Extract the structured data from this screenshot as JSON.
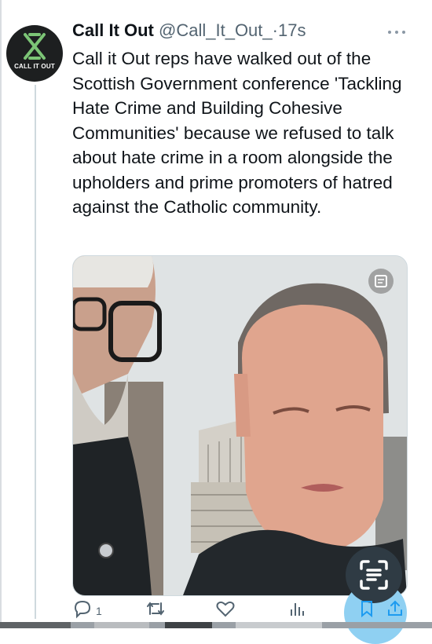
{
  "tweet": {
    "display_name": "Call It Out",
    "handle": "@Call_It_Out_",
    "separator": "·",
    "timestamp": "17s",
    "text": "Call it Out reps have walked out of the Scottish Government conference 'Tackling Hate Crime and Building Cohesive Communities' because we refused to talk about hate crime in a room alongside the upholders and prime promoters of hatred against the Catholic community.",
    "avatar_text": "CALL IT OUT",
    "reply_count": "1"
  },
  "icons": {
    "more": "more-icon",
    "alt_text": "alt-badge-icon",
    "scan": "text-scan-icon",
    "reply": "reply-icon",
    "retweet": "retweet-icon",
    "like": "like-icon",
    "views": "views-icon",
    "bookmark": "bookmark-icon",
    "share": "share-icon"
  },
  "colors": {
    "text": "#0f1419",
    "secondary": "#536471",
    "avatar_bg": "#1d1f20",
    "avatar_mark": "#7cc576",
    "accent_blue": "#1d9bf0"
  }
}
